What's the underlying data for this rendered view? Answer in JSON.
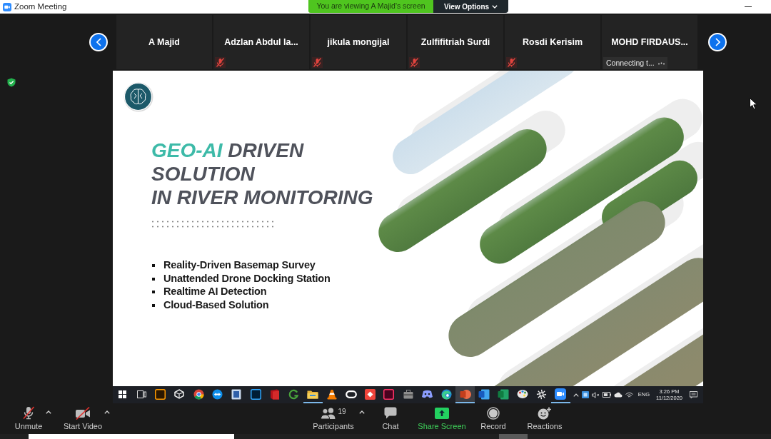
{
  "window": {
    "title": "Zoom Meeting"
  },
  "share_banner": {
    "message": "You are viewing A Majid's screen",
    "view_options": "View Options"
  },
  "gallery": {
    "tiles": [
      {
        "name": "A Majid",
        "muted": false
      },
      {
        "name": "Adzlan Abdul la...",
        "muted": true
      },
      {
        "name": "jikula mongijal",
        "muted": true
      },
      {
        "name": "Zulfifitriah Surdi",
        "muted": true
      },
      {
        "name": "Rosdi Kerisim",
        "muted": true
      },
      {
        "name": "MOHD FIRDAUS...",
        "muted": false,
        "status": "Connecting t..."
      }
    ]
  },
  "slide": {
    "title_lines": [
      [
        {
          "text": "GEO-AI",
          "accent": true
        },
        {
          "text": "DRIVEN",
          "accent": false
        }
      ],
      [
        {
          "text": "SOLUTION",
          "accent": false
        }
      ],
      [
        {
          "text": "IN RIVER MONITORING",
          "accent": false
        }
      ]
    ],
    "bullets": [
      "Reality-Driven Basemap Survey",
      "Unattended Drone Docking Station",
      "Realtime AI Detection",
      "Cloud-Based Solution"
    ]
  },
  "taskbar": {
    "apps": [
      {
        "kind": "start",
        "running": false,
        "selected": false
      },
      {
        "kind": "taskview",
        "running": false,
        "selected": false
      },
      {
        "kind": "illustrator",
        "running": false,
        "selected": false
      },
      {
        "kind": "unity",
        "running": false,
        "selected": false
      },
      {
        "kind": "chrome",
        "running": false,
        "selected": false
      },
      {
        "kind": "teamviewer",
        "running": false,
        "selected": false
      },
      {
        "kind": "notes",
        "running": false,
        "selected": false
      },
      {
        "kind": "photoshop",
        "running": false,
        "selected": false
      },
      {
        "kind": "redbook",
        "running": false,
        "selected": false
      },
      {
        "kind": "swirl",
        "running": false,
        "selected": false
      },
      {
        "kind": "explorer",
        "running": true,
        "selected": false
      },
      {
        "kind": "vlc",
        "running": false,
        "selected": false
      },
      {
        "kind": "oculus",
        "running": false,
        "selected": false
      },
      {
        "kind": "anydesk",
        "running": false,
        "selected": false
      },
      {
        "kind": "indesign",
        "running": false,
        "selected": false
      },
      {
        "kind": "tools",
        "running": false,
        "selected": false
      },
      {
        "kind": "discord",
        "running": false,
        "selected": false
      },
      {
        "kind": "edge",
        "running": false,
        "selected": false
      },
      {
        "kind": "powerpoint",
        "running": true,
        "selected": true
      },
      {
        "kind": "word",
        "running": false,
        "selected": false
      },
      {
        "kind": "excel",
        "running": false,
        "selected": false
      },
      {
        "kind": "paint",
        "running": false,
        "selected": false
      },
      {
        "kind": "aperture",
        "running": false,
        "selected": false
      },
      {
        "kind": "zoom",
        "running": true,
        "selected": false
      }
    ],
    "language": "ENG",
    "time": "3:26 PM",
    "date": "11/12/2020"
  },
  "toolbar": {
    "buttons": [
      {
        "kind": "audio",
        "label": "Unmute",
        "off": true,
        "menu": true
      },
      {
        "kind": "video",
        "label": "Start Video",
        "off": true,
        "menu": true
      },
      {
        "kind": "participants",
        "label": "Participants",
        "count": "19",
        "menu": true
      },
      {
        "kind": "chat",
        "label": "Chat",
        "menu": false
      },
      {
        "kind": "share",
        "label": "Share Screen",
        "menu": false
      },
      {
        "kind": "record",
        "label": "Record",
        "menu": false
      },
      {
        "kind": "reactions",
        "label": "Reactions",
        "menu": false
      }
    ]
  }
}
